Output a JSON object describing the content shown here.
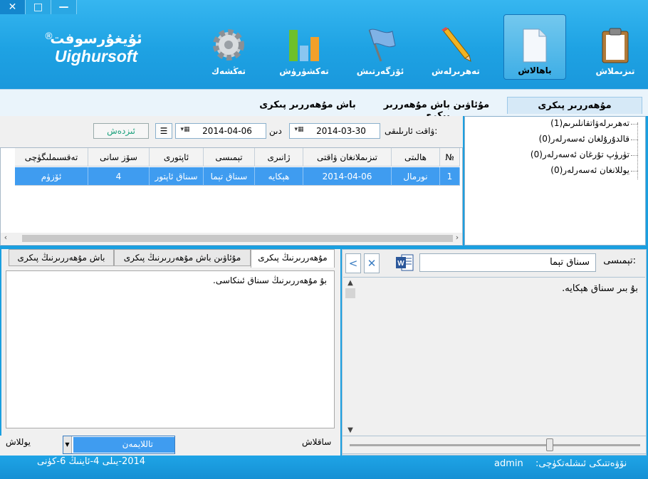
{
  "window": {
    "close_glyph": "✕",
    "maximize_glyph": "□",
    "minimize_glyph": "—"
  },
  "logo": {
    "uyghur": "ئۇيغۇرسوفت",
    "english": "Uighursoft",
    "registered": "®"
  },
  "toolbar": [
    {
      "label": "تىزىملاش",
      "icon": "clipboard-icon"
    },
    {
      "label": "باھالاش",
      "icon": "document-icon",
      "active": true
    },
    {
      "label": "تەھرىرلەش",
      "icon": "pencil-icon"
    },
    {
      "label": "ئۆزگەرتىش",
      "icon": "flag-icon"
    },
    {
      "label": "تەكشۈرۈش",
      "icon": "bar-chart-icon"
    },
    {
      "label": "تەڭشەك",
      "icon": "gear-icon"
    }
  ],
  "tabs": {
    "received": "مۇھەررىر پىكرى",
    "sent": "مۇئاۋىن باش مۇھەررىر پىكرى",
    "draft": "باش مۇھەررىر پىكرى"
  },
  "tree": [
    "تەھرىرلەۋاتقانلىرىم(1)",
    "قالدۇرۇلغان ئەسەرلەر(0)",
    "تۈرۈپ تۇرغان ئەسەرلەر(0)",
    "يوللانغان ئەسەرلەر(0)"
  ],
  "filter": {
    "time_label": "ۋاقت ئارىلىقى:",
    "date_from": "2014-03-30",
    "to_label": "دىن",
    "date_to": "2014-04-06",
    "search_button": "ئىزدەش",
    "list_glyph": "☰"
  },
  "grid": {
    "columns": [
      "№",
      "ھالىتى",
      "تىزىملانغان ۋاقتى",
      "ژانىرى",
      "تېمىسى",
      "ئاپتورى",
      "سۆز سانى",
      "تەقسىملىگۈچى"
    ],
    "rows": [
      [
        "1",
        "نورمال",
        "2014-04-06",
        "ھېكايە",
        "سىناق تېما",
        "سىناق ئاپتور",
        "4",
        "ئۆزۈم"
      ]
    ]
  },
  "preview": {
    "subject_label": "تېمىسى:",
    "subject_value": "سىناق تېما",
    "body_text": "بۇ بىر سىناق ھېكايە.",
    "word_icon": "word-icon",
    "clear_glyph": "✕",
    "prev_glyph": "<"
  },
  "comments": {
    "tab_editor": "مۇھەررىرنىڭ پىكرى",
    "tab_deputy": "مۇئاۋىن باش مۇھەررىرنىڭ پىكرى",
    "tab_chief": "باش مۇھەررىرنىڭ پىكرى",
    "text": "بۇ مۇھەررىرنىڭ سىناق ئىنكاسى."
  },
  "bottom": {
    "save_label": "ساقلاش",
    "select_value": "تاللايمەن",
    "send_label": "يوللاش"
  },
  "status": {
    "date": "2014-يىلى 4-ئاينىڭ 6-كۈنى",
    "user_label": "نۆۋەتتىكى ئىشلەتكۈچى:",
    "user": "admin"
  }
}
